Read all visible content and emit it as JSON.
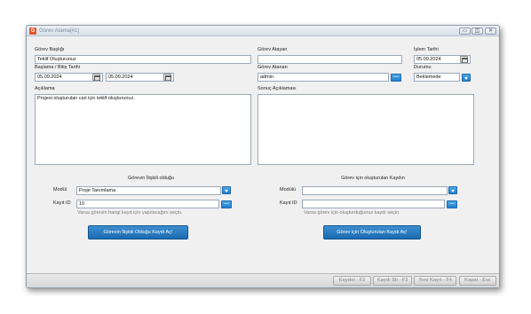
{
  "window": {
    "title": "Görev Atama[41]"
  },
  "form": {
    "gorev_basligi": {
      "label": "Görev Başlığı",
      "value": "Teklif Oluşturunuz"
    },
    "gorev_atayan": {
      "label": "Görev Atayan",
      "value": ""
    },
    "islem_tarihi": {
      "label": "İşlem Tarihi",
      "value": "05.09.2024"
    },
    "baslama_bitis": {
      "label": "Başlama / Bitiş Tarihi",
      "start": "05.09.2024",
      "end": "05.09.2024"
    },
    "gorev_atanan": {
      "label": "Görev Atanan",
      "value": "admin"
    },
    "durumu": {
      "label": "Durumu",
      "value": "Beklemede"
    },
    "aciklama": {
      "label": "Açıklama",
      "value": "Projesi oluşturulan cari için teklif oluşturunuz."
    },
    "sonuc_aciklamasi": {
      "label": "Sonuç Açıklaması",
      "value": ""
    }
  },
  "left_section": {
    "title": "Görevin İlişkili olduğu",
    "modul_label": "Modül",
    "modul_value": "Proje Tanımlama",
    "kayit_label": "Kayıt ID",
    "kayit_value": "10",
    "hint": "Varsa görevin hangi kayıt için yapılacağını seçin.",
    "button": "Görevin İlişkili Olduğu Kaydı Aç!"
  },
  "right_section": {
    "title": "Görev için oluşturulan Kaydın",
    "modul_label": "Modülü",
    "modul_value": "",
    "kayit_label": "Kayıt ID",
    "kayit_value": "",
    "hint": "Varsa görev için oluşturduğunuz kaydı seçin",
    "button": "Görev için Oluşturulan Kaydı Aç!"
  },
  "footer": {
    "save": "Kaydet - F2",
    "delete": "Kaydı Sil - F3",
    "new": "Yeni Kayıt - F4",
    "close": "Kapat - Esc"
  },
  "icons": {
    "calendar": "calendar-icon",
    "dropdown": "chevron-down-icon",
    "ellipsis": "ellipsis-icon"
  },
  "colors": {
    "accent": "#1f7fcf",
    "app_icon": "#e8542c"
  }
}
